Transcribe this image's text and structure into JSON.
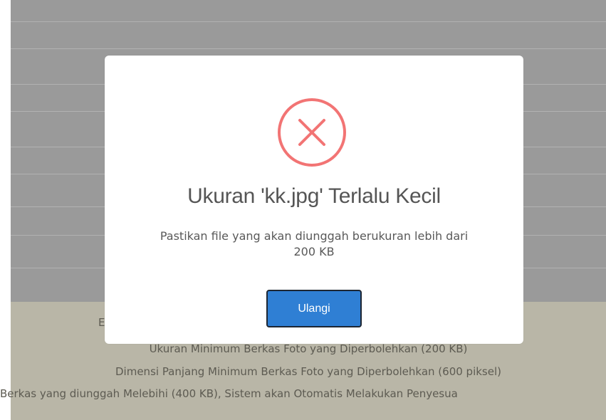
{
  "dialog": {
    "title": "Ukuran 'kk.jpg' Terlalu Kecil",
    "message_line1": "Pastikan file yang akan diunggah berukuran lebih dari",
    "message_line2": "200 KB",
    "retry_label": "Ulangi",
    "icon": "error-x-icon",
    "icon_color": "#f27474",
    "button_color": "#2f7fd4"
  },
  "background_info": {
    "line1": "E",
    "line2": "Ukuran Minimum Berkas Foto yang Diperbolehkan (200 KB)",
    "line3": "Dimensi Panjang Minimum Berkas Foto yang Diperbolehkan (600 piksel)",
    "line4": "Berkas yang diunggah Melebihi (400 KB), Sistem akan Otomatis Melakukan Penyesua"
  }
}
